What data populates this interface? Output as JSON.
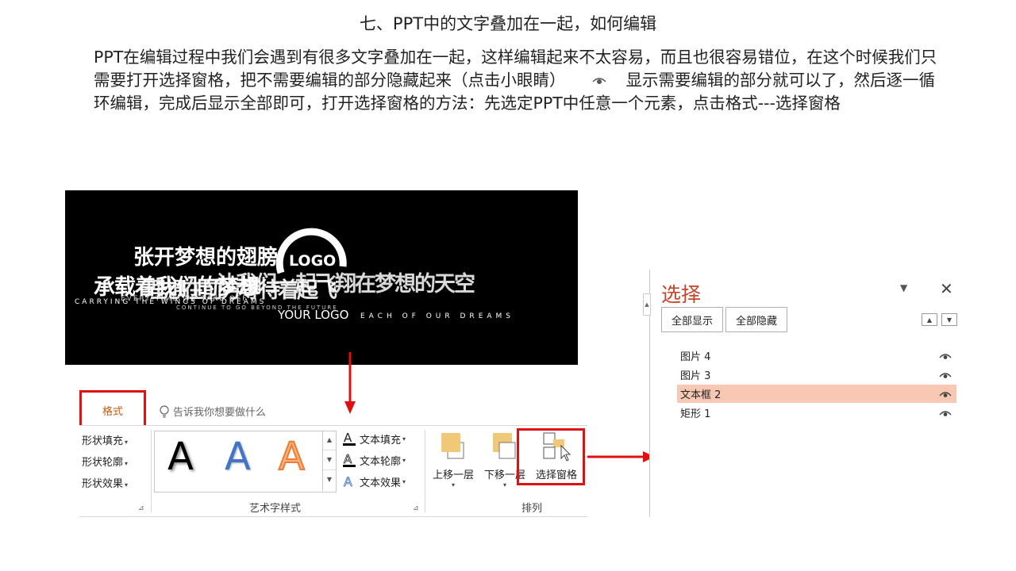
{
  "heading": "七、PPT中的文字叠加在一起，如何编辑",
  "paragraph": {
    "part1": "PPT在编辑过程中我们会遇到有很多文字叠加在一起，这样编辑起来不太容易，而且也很容易错位，在这个时候我们只需要打开选择窗格，把不需要编辑的部分隐藏起来（点击小眼睛）",
    "part2": "显示需要编辑的部分就可以了，然后逐一循环编辑，完成后显示全部即可，打开选择窗格的方法：先选定PPT中任意一个元素，点击格式---选择窗格"
  },
  "slide": {
    "wing_text": "张开梦想的翅膀",
    "line1": "承载着我们的梦想",
    "line1b": "理想在前方等待着起飞",
    "line1c": "让我们一起飞翔在梦想的天空",
    "logo_text": "LOGO",
    "en1": "CARRYING THE WINGS OF DREAMS",
    "en2": "EVERY TIME WE TAKE OFF",
    "en3": "CONTINUE TO GO BEYOND THE FUTURE",
    "your_logo": "YOUR LOGO",
    "dreams": "EACH OF OUR DREAMS"
  },
  "ribbon": {
    "tab_format": "格式",
    "tell_me": "告诉我你想要做什么",
    "shape_fill": "形状填充",
    "shape_outline": "形状轮廓",
    "shape_effects": "形状效果",
    "text_fill": "文本填充",
    "text_outline": "文本轮廓",
    "text_effects": "文本效果",
    "wordart_group": "艺术字样式",
    "arrange_group": "排列",
    "bring_forward": "上移一层",
    "send_backward": "下移一层",
    "selection_pane": "选择窗格",
    "gallery_letter": "A"
  },
  "pane": {
    "title": "选择",
    "show_all": "全部显示",
    "hide_all": "全部隐藏",
    "items": [
      {
        "label": "图片 4",
        "selected": false
      },
      {
        "label": "图片 3",
        "selected": false
      },
      {
        "label": "文本框 2",
        "selected": true
      },
      {
        "label": "矩形 1",
        "selected": false
      }
    ]
  },
  "colors": {
    "red": "#e01010",
    "accent": "#c5452a",
    "selected_row": "#f8c8b4"
  }
}
